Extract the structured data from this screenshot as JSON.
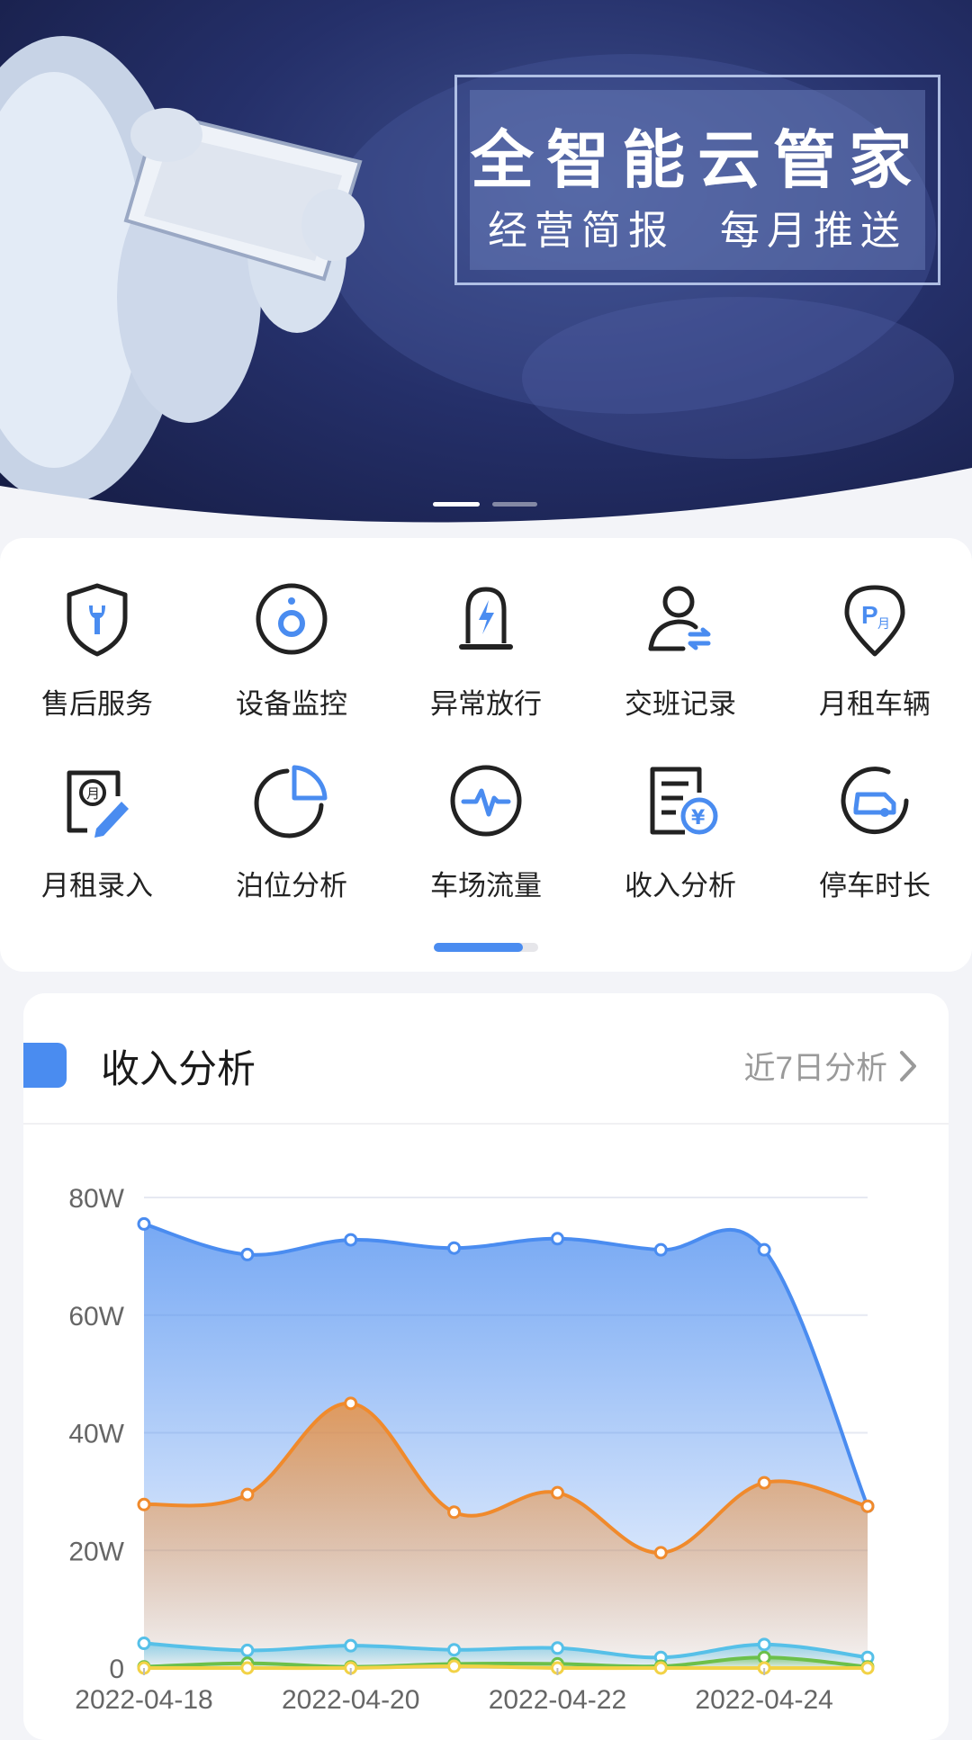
{
  "banner": {
    "title": "全智能云管家",
    "subtitle_left": "经营简报",
    "subtitle_right": "每月推送",
    "slides": 2,
    "active_slide": 1
  },
  "menu": {
    "items": [
      {
        "label": "售后服务",
        "icon": "shield-wrench-icon"
      },
      {
        "label": "设备监控",
        "icon": "camera-monitor-icon"
      },
      {
        "label": "异常放行",
        "icon": "barrier-lightning-icon"
      },
      {
        "label": "交班记录",
        "icon": "user-handover-icon"
      },
      {
        "label": "月租车辆",
        "icon": "parking-month-pin-icon"
      },
      {
        "label": "月租录入",
        "icon": "month-entry-edit-icon"
      },
      {
        "label": "泊位分析",
        "icon": "pie-chart-icon"
      },
      {
        "label": "车场流量",
        "icon": "pulse-circle-icon"
      },
      {
        "label": "收入分析",
        "icon": "document-yuan-icon"
      },
      {
        "label": "停车时长",
        "icon": "car-clock-icon"
      }
    ],
    "page_progress": 0.85
  },
  "income": {
    "title": "收入分析",
    "link_label": "近7日分析",
    "accent": "#4a8cf0"
  },
  "chart_data": {
    "type": "area",
    "x": [
      "2022-04-18",
      "2022-04-19",
      "2022-04-20",
      "2022-04-21",
      "2022-04-22",
      "2022-04-23",
      "2022-04-24",
      "2022-04-25"
    ],
    "x_tick_labels": [
      "2022-04-18",
      "2022-04-20",
      "2022-04-22",
      "2022-04-24"
    ],
    "y_tick_labels": [
      "0",
      "20W",
      "40W",
      "60W",
      "80W"
    ],
    "ylim": [
      0,
      80
    ],
    "grid": true,
    "series": [
      {
        "color": "#4a8cf0",
        "values": [
          75.5,
          70.3,
          72.8,
          71.4,
          73.0,
          71.1,
          71.1,
          27.5
        ]
      },
      {
        "color": "#f08a2c",
        "values": [
          27.8,
          29.5,
          45.0,
          26.5,
          29.8,
          19.6,
          31.5,
          27.5
        ]
      },
      {
        "color": "#56c0e8",
        "values": [
          4.2,
          3.0,
          3.8,
          3.1,
          3.4,
          1.8,
          4.0,
          1.8
        ]
      },
      {
        "color": "#6cc04a",
        "values": [
          0.2,
          0.8,
          0.2,
          0.7,
          0.7,
          0.3,
          1.8,
          0.2
        ]
      },
      {
        "color": "#f2d246",
        "values": [
          0,
          0,
          0,
          0.3,
          0,
          0,
          0,
          0
        ]
      }
    ]
  }
}
